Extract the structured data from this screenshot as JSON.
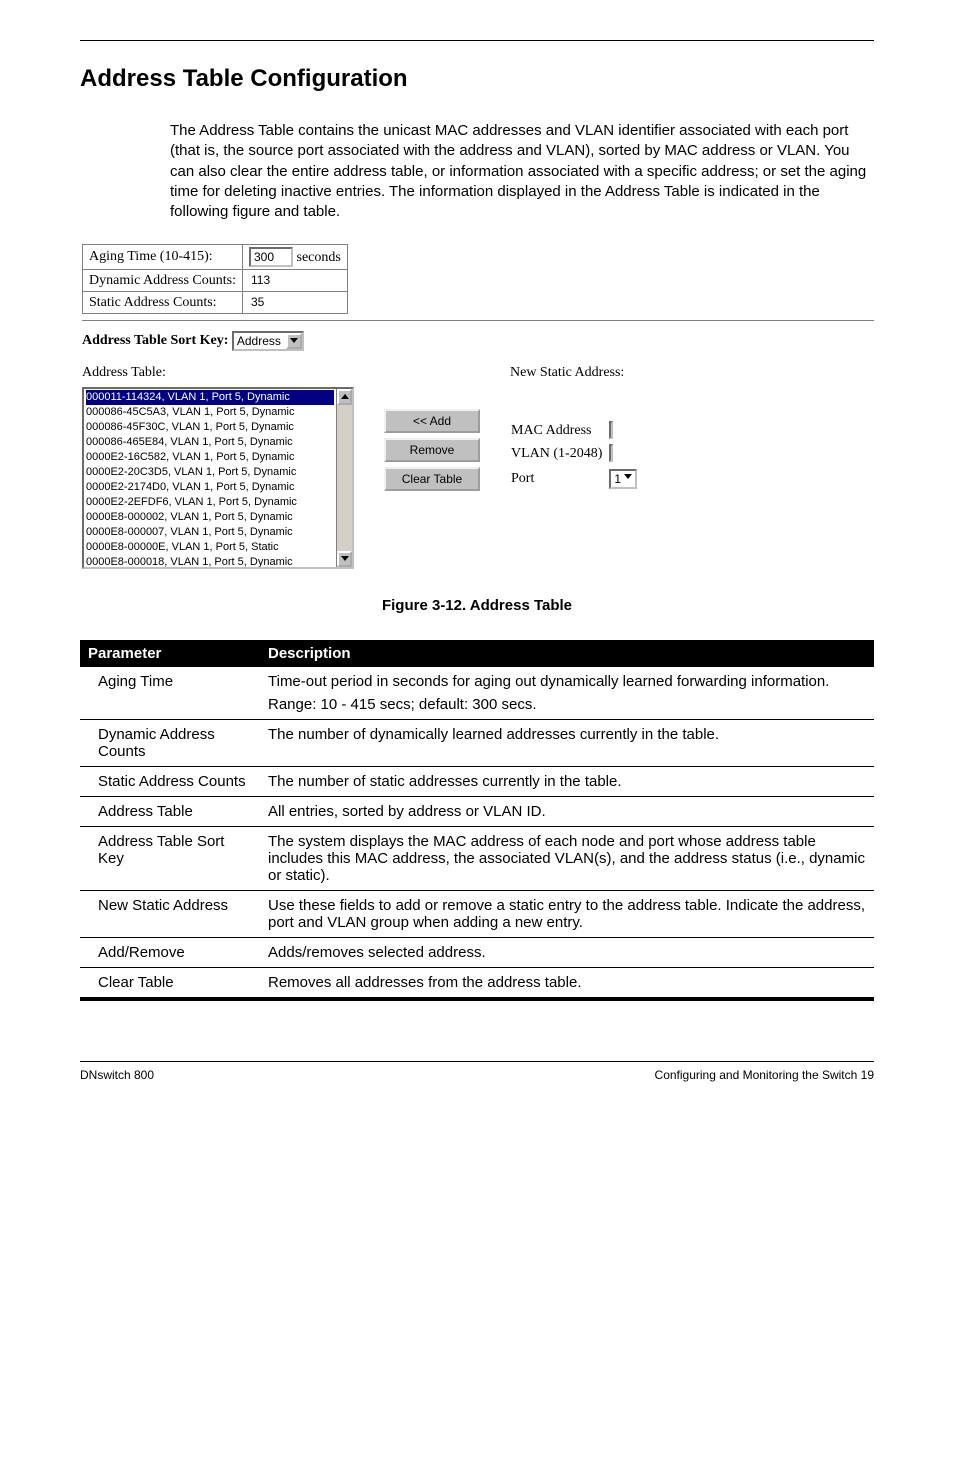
{
  "header": {
    "title": "Address Table Configuration"
  },
  "intro": "The Address Table contains the unicast MAC addresses and VLAN identifier associated with each port (that is, the source port associated with the address and VLAN), sorted by MAC address or VLAN. You can also clear the entire address table, or information associated with a specific address; or set the aging time for deleting inactive entries. The information displayed in the Address Table is indicated in the following figure and table.",
  "aging": {
    "label": "Aging Time (10-415):",
    "value": "300",
    "unit": "seconds",
    "dyn_label": "Dynamic Address Counts:",
    "dyn_value": "113",
    "static_label": "Static Address Counts:",
    "static_value": "35"
  },
  "sortkey": {
    "label": "Address Table Sort Key:",
    "selected": "Address"
  },
  "address_table": {
    "label": "Address Table:",
    "items": [
      "000011-114324, VLAN 1, Port 5, Dynamic",
      "000086-45C5A3, VLAN 1, Port 5, Dynamic",
      "000086-45F30C, VLAN 1, Port 5, Dynamic",
      "000086-465E84, VLAN 1, Port 5, Dynamic",
      "0000E2-16C582, VLAN 1, Port 5, Dynamic",
      "0000E2-20C3D5, VLAN 1, Port 5, Dynamic",
      "0000E2-2174D0, VLAN 1, Port 5, Dynamic",
      "0000E2-2EFDF6, VLAN 1, Port 5, Dynamic",
      "0000E8-000002, VLAN 1, Port 5, Dynamic",
      "0000E8-000007, VLAN 1, Port 5, Dynamic",
      "0000E8-00000E, VLAN 1, Port 5, Static",
      "0000E8-000018, VLAN 1, Port 5, Dynamic"
    ]
  },
  "buttons": {
    "add": "<< Add",
    "remove": "Remove",
    "clear": "Clear Table"
  },
  "new_static": {
    "label": "New Static Address:",
    "mac_label": "MAC Address",
    "vlan_label": "VLAN (1-2048)",
    "port_label": "Port",
    "port_value": "1"
  },
  "figure_caption": "Figure 3-12.  Address Table",
  "params_header": {
    "p": "Parameter",
    "d": "Description"
  },
  "params": [
    {
      "p": "Aging Time",
      "d": "Time-out period in seconds for aging out dynamically learned forwarding information.",
      "d2": "Range: 10 - 415 secs; default: 300 secs."
    },
    {
      "p": "Dynamic Address Counts",
      "d": "The number of dynamically learned addresses currently in the table."
    },
    {
      "p": "Static Address Counts",
      "d": "The number of static addresses currently in the table."
    },
    {
      "p": "Address Table",
      "d": "All entries, sorted by address or VLAN ID."
    },
    {
      "p": "Address Table Sort Key",
      "d": "The system displays the MAC address of each node and port whose address table includes this MAC address, the associated VLAN(s), and the address status (i.e., dynamic or static)."
    },
    {
      "p": "New Static Address",
      "d": "Use these fields to add or remove a static entry to the address table. Indicate the address, port and VLAN group when adding a new entry."
    },
    {
      "p": "Add/Remove",
      "d": "Adds/removes selected address."
    },
    {
      "p": "Clear Table",
      "d": "Removes all addresses from the address table."
    }
  ],
  "footer": {
    "left": "DNswitch 800",
    "right": "Configuring and Monitoring the Switch  19"
  }
}
